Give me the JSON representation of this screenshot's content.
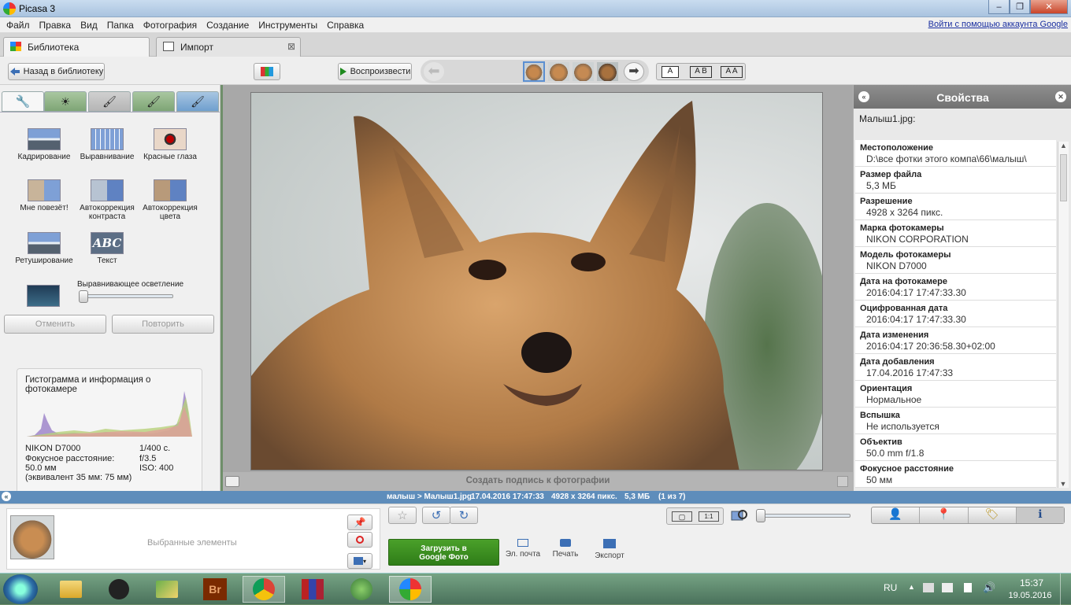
{
  "window": {
    "title": "Picasa 3",
    "minimize": "–",
    "maximize": "❐",
    "close": "✕"
  },
  "menu": [
    "Файл",
    "Правка",
    "Вид",
    "Папка",
    "Фотография",
    "Создание",
    "Инструменты",
    "Справка"
  ],
  "login_link": "Войти с помощью аккаунта Google",
  "tabs": {
    "library": "Библиотека",
    "import": "Импорт",
    "close_glyph": "⊠"
  },
  "toolbar": {
    "back": "Назад в библиотеку",
    "play": "Воспроизвести",
    "view_a": "A",
    "view_ab": "A B",
    "view_aa": "A A"
  },
  "edit_tools": {
    "tools": [
      "Кадрирование",
      "Выравнивание",
      "Красные глаза",
      "Мне повезёт!",
      "Автокоррекция контраста",
      "Автокоррекция цвета",
      "Ретуширование",
      "Текст"
    ],
    "text_thumb": "ABC",
    "fill_light_label": "Выравнивающее осветление",
    "fill_light_level": 0,
    "undo": "Отменить",
    "redo": "Повторить"
  },
  "histogram": {
    "title": "Гистограмма и информация о фотокамере",
    "camera": "NIKON D7000",
    "shutter": "1/400 с.",
    "focal_label": "Фокусное расстояние:",
    "aperture": "f/3.5",
    "focal_value": "50.0 мм",
    "iso": "ISO: 400",
    "equiv": "(эквивалент 35 мм:  75 мм)"
  },
  "caption": {
    "placeholder": "Создать подпись к фотографии"
  },
  "properties": {
    "title": "Свойства",
    "filename": "Малыш1.jpg:",
    "items": [
      {
        "k": "Местоположение",
        "v": "D:\\все фотки этого компа\\66\\малыш\\"
      },
      {
        "k": "Размер файла",
        "v": "5,3 МБ"
      },
      {
        "k": "Разрешение",
        "v": "4928 x 3264 пикс."
      },
      {
        "k": "Марка фотокамеры",
        "v": "NIKON CORPORATION"
      },
      {
        "k": "Модель фотокамеры",
        "v": "NIKON D7000"
      },
      {
        "k": "Дата на фотокамере",
        "v": "2016:04:17 17:47:33.30"
      },
      {
        "k": "Оцифрованная дата",
        "v": "2016:04:17 17:47:33.30"
      },
      {
        "k": "Дата изменения",
        "v": "2016:04:17 20:36:58.30+02:00"
      },
      {
        "k": "Дата добавления",
        "v": "17.04.2016 17:47:33"
      },
      {
        "k": "Ориентация",
        "v": "Нормальное"
      },
      {
        "k": "Вспышка",
        "v": "Не используется"
      },
      {
        "k": "Объектив",
        "v": "50.0 mm f/1.8"
      },
      {
        "k": "Фокусное расстояние",
        "v": "50 мм"
      }
    ]
  },
  "status": {
    "path": "малыш > Малыш1.jpg",
    "date": "17.04.2016 17:47:33",
    "resolution": "4928 x 3264 пикс.",
    "size": "5,3 МБ",
    "count": "(1 из 7)"
  },
  "tray": {
    "selected_label": "Выбранные элементы",
    "upload": "Загрузить в",
    "upload2": "Google Фото",
    "email": "Эл. почта",
    "print": "Печать",
    "export": "Экспорт",
    "zoom_fit": "▢",
    "zoom_11": "1:1",
    "zoom_level": 0
  },
  "taskbar": {
    "lang": "RU",
    "time": "15:37",
    "date": "19.05.2016",
    "apps": [
      "explorer",
      "spy",
      "folders",
      "bridge",
      "chrome",
      "winrar",
      "globe",
      "picasa"
    ],
    "bridge_label": "Br"
  },
  "colors": {
    "accent_green": "#3a8a1d",
    "status_blue": "#5e8dbb",
    "panel_grey": "#727272"
  }
}
